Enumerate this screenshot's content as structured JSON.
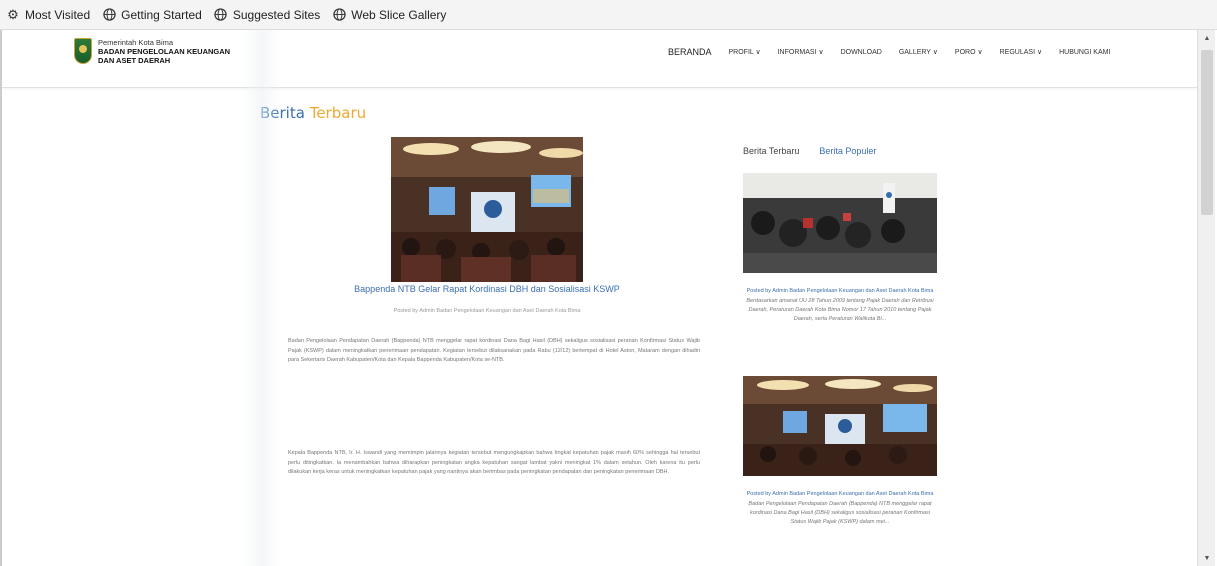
{
  "favorites": [
    {
      "icon": "gear-icon",
      "label": "Most Visited"
    },
    {
      "icon": "globe-icon",
      "label": "Getting Started"
    },
    {
      "icon": "globe-icon",
      "label": "Suggested Sites"
    },
    {
      "icon": "globe-icon",
      "label": "Web Slice Gallery"
    }
  ],
  "site": {
    "logo_line1": "Pemerintah Kota Bima",
    "logo_line2": "BADAN PENGELOLAAN KEUANGAN",
    "logo_line3": "DAN ASET DAERAH"
  },
  "nav": [
    "BERANDA",
    "PROFIL ∨",
    "INFORMASI ∨",
    "DOWNLOAD",
    "GALLERY ∨",
    "PORO ∨",
    "REGULASI ∨",
    "HUBUNGI KAMI"
  ],
  "section": {
    "title_part1": "Berita",
    "title_part2": "Terbaru"
  },
  "article": {
    "title": "Bappenda NTB Gelar Rapat Kordinasi DBH dan Sosialisasi KSWP",
    "meta": "Posted by Admin Badan Pengelolaan Keuangan dan Aset Daerah Kota Bima",
    "paragraph1": "Badan Pengelolaan Pendapatan Daerah (Bappenda) NTB menggelar rapat kordinasi Dana Bagi Hasil (DBH) sekaligus sosialisasi peranan Konfirmasi Status Wajib Pajak (KSWP) dalam meningkatkan penerimaan pendapatan. Kegiatan tersebut dilaksanakan pada Rabu (12/12) bertempat di Hotel Aston, Mataram dengan dihadiri para Sekertaris Daerah Kabupaten/Kota dan Kepala Bappenda Kabupaten/Kota se-NTB.",
    "paragraph2": "Kepala Bappenda NTB, Ir. H. Iswandi yang memimpin jalannya kegiatan tersebut mengungkapkan bahwa tingkat kepatuhan pajak masih 60% sehingga hal tersebut perlu ditingkatkan. Ia menambahkan bahwa diharapkan peningkatan angka kepatuhan sangat lambat yakni meningkat 1% dalam setahun. Oleh karena itu perlu dilakukan kerja keras untuk meningkatkan kepatuhan pajak yang nantinya akan berimbas pada peningkatan pendapatan dan peningkatan penerimaan DBH."
  },
  "sidebar": {
    "tab_latest": "Berita Terbaru",
    "tab_popular": "Berita Populer",
    "cards": [
      {
        "meta": "Posted by Admin Badan Pengelolaan Keuangan dan Aset Daerah Kota Bima",
        "excerpt": "Berdasarkan amanat UU 28 Tahun 2009 tentang Pajak Daerah dan Retribusi Daerah, Peraturan Daerah Kota Bima Nomor 17 Tahun 2010 tentang Pajak Daerah, serta Peraturan Walikota Bi..."
      },
      {
        "meta": "Posted by Admin Badan Pengelolaan Keuangan dan Aset Daerah Kota Bima",
        "excerpt": "Badan Pengelolaan Pendapatan Daerah (Bappenda) NTB menggelar rapat kordinasi Dana Bagi Hasil (DBH) sekaligus sosialisasi peranan Konfirmasi Status Wajib Pajak (KSWP) dalam mei..."
      }
    ]
  },
  "colors": {
    "link_blue": "#3a6fb0",
    "accent_orange": "#f0a830"
  }
}
